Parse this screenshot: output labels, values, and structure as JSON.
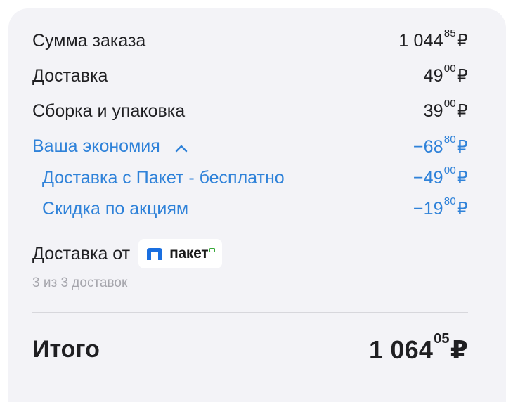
{
  "summary": {
    "rows": [
      {
        "label": "Сумма заказа",
        "main": "1 044",
        "cents": "85",
        "currency": "₽"
      },
      {
        "label": "Доставка",
        "main": "49",
        "cents": "00",
        "currency": "₽"
      },
      {
        "label": "Сборка и упаковка",
        "main": "39",
        "cents": "00",
        "currency": "₽"
      }
    ],
    "savings": {
      "label": "Ваша экономия",
      "main": "−68",
      "cents": "80",
      "currency": "₽",
      "items": [
        {
          "label": "Доставка с Пакет - бесплатно",
          "main": "−49",
          "cents": "00",
          "currency": "₽"
        },
        {
          "label": "Скидка по акциям",
          "main": "−19",
          "cents": "80",
          "currency": "₽"
        }
      ]
    }
  },
  "delivery": {
    "label": "Доставка от",
    "brand": "пакет",
    "count_text": "3 из 3 доставок"
  },
  "total": {
    "label": "Итого",
    "main": "1 064",
    "cents": "05",
    "currency": "₽"
  },
  "colors": {
    "accent": "#2f82d9",
    "card_bg": "#f3f3f7",
    "muted": "#a6a6ad",
    "brand_blue": "#1a6fe0"
  },
  "icons": {
    "savings_toggle": "chevron-up-icon",
    "brand_logo": "paket-logo-icon"
  }
}
